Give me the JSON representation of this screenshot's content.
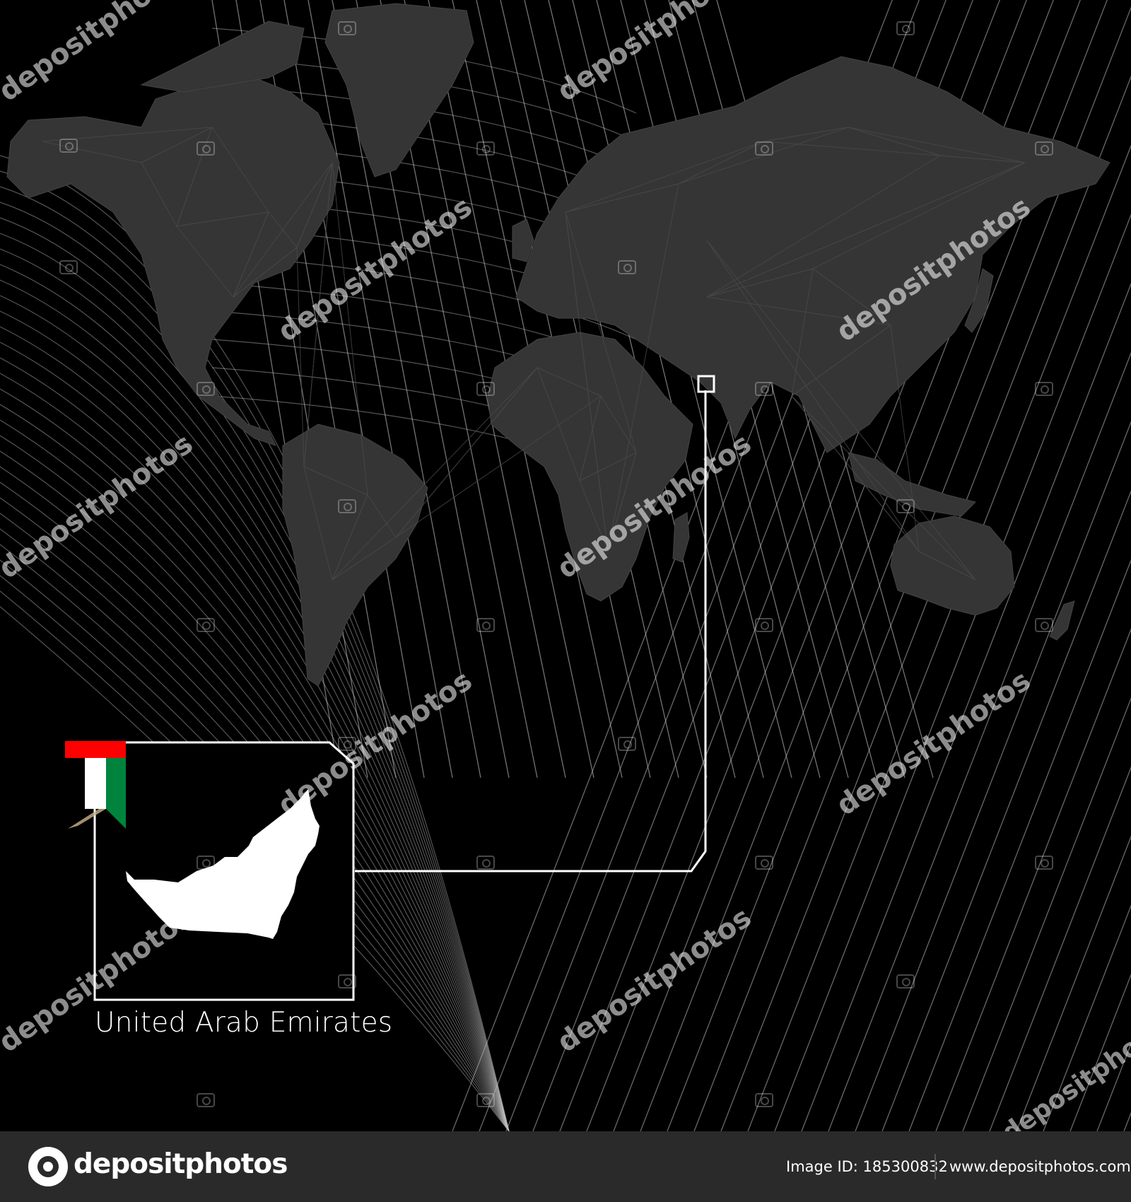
{
  "map": {
    "country_label": "United Arab Emirates",
    "background_color": "#000000",
    "land_color": "#3a3a3a",
    "grid_color": "#bfbfbf",
    "highlight_color": "#ffffff",
    "flag_colors": {
      "red": "#ff0000",
      "white": "#ffffff",
      "green": "#00843d"
    }
  },
  "watermark": {
    "text": "depositphotos"
  },
  "footer": {
    "logo_text": "depositphotos",
    "image_id": "Image ID: 185300832",
    "site": "www.depositphotos.com"
  }
}
